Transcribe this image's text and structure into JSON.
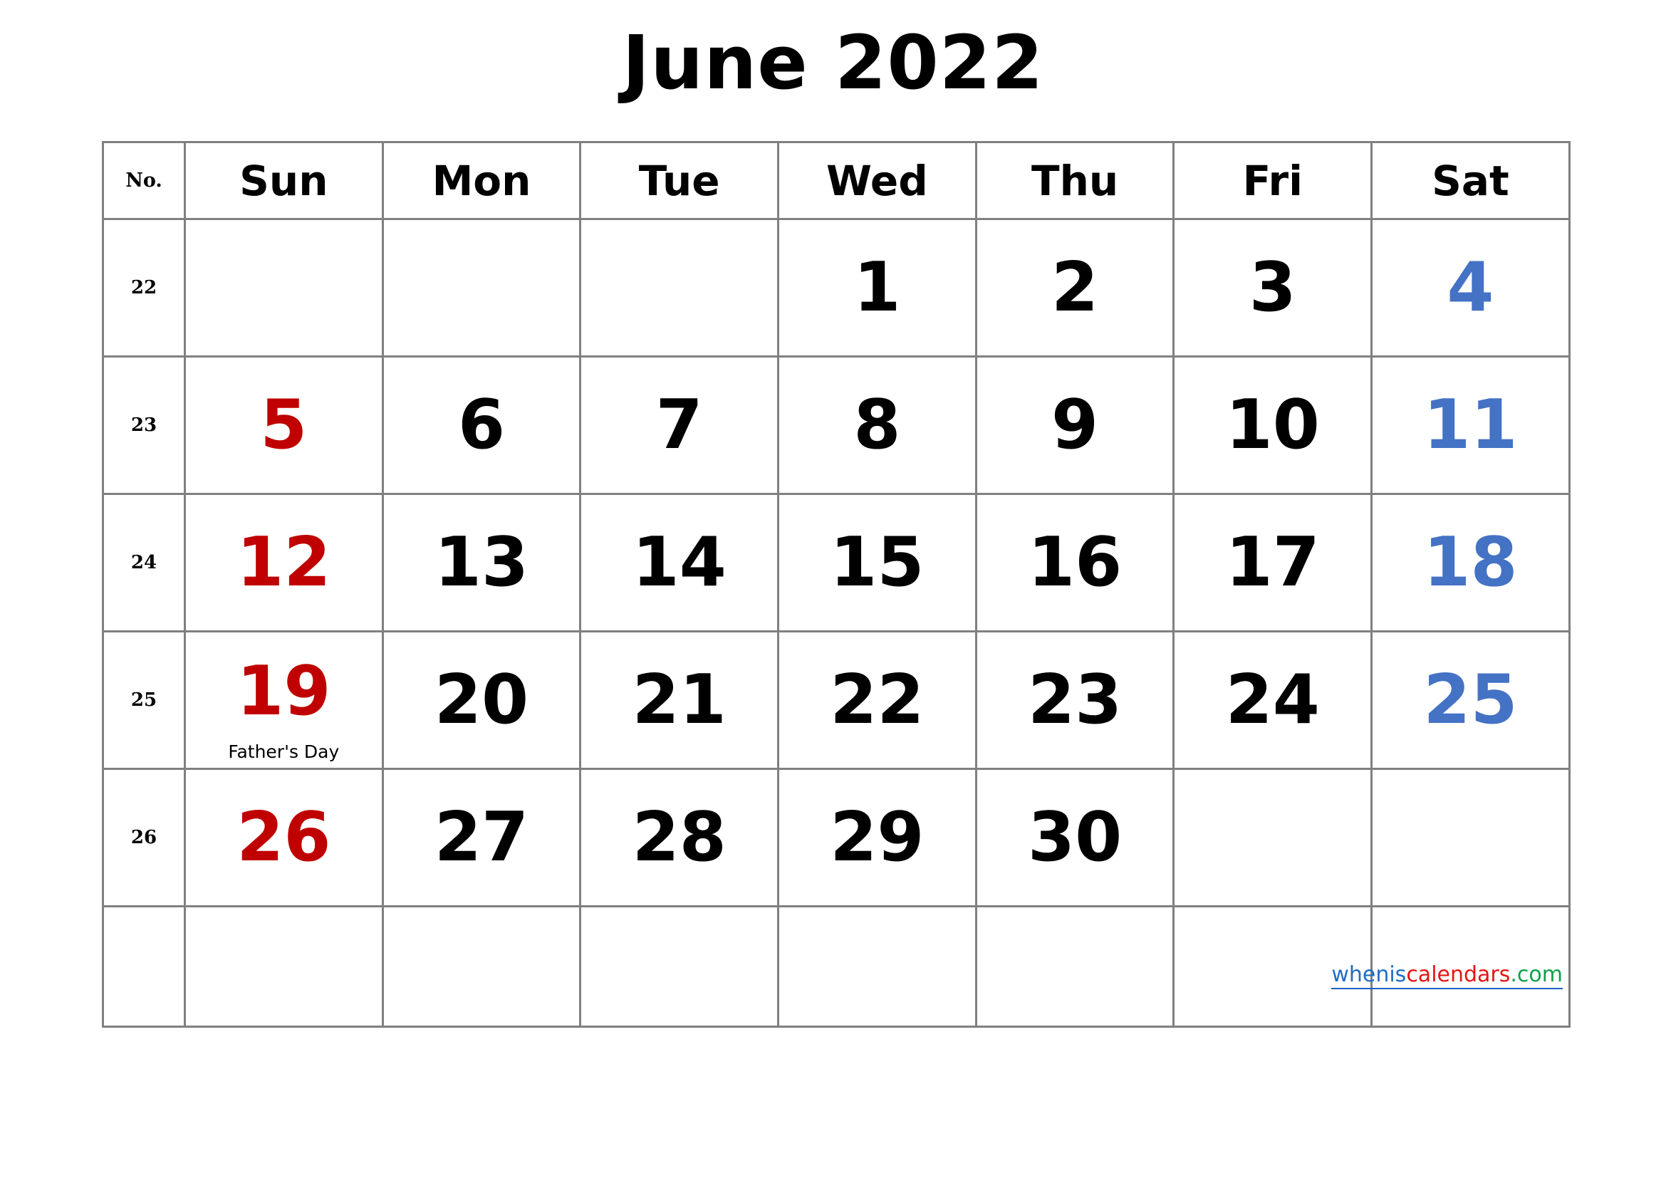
{
  "title": "June 2022",
  "table": {
    "week_number_header": "No.",
    "day_headers": [
      "Sun",
      "Mon",
      "Tue",
      "Wed",
      "Thu",
      "Fri",
      "Sat"
    ],
    "weeks": [
      {
        "week_number": "22",
        "days": [
          {
            "num": "",
            "type": "empty",
            "event": ""
          },
          {
            "num": "",
            "type": "empty",
            "event": ""
          },
          {
            "num": "",
            "type": "empty",
            "event": ""
          },
          {
            "num": "1",
            "type": "weekday",
            "event": ""
          },
          {
            "num": "2",
            "type": "weekday",
            "event": ""
          },
          {
            "num": "3",
            "type": "weekday",
            "event": ""
          },
          {
            "num": "4",
            "type": "saturday",
            "event": ""
          }
        ]
      },
      {
        "week_number": "23",
        "days": [
          {
            "num": "5",
            "type": "sunday",
            "event": ""
          },
          {
            "num": "6",
            "type": "weekday",
            "event": ""
          },
          {
            "num": "7",
            "type": "weekday",
            "event": ""
          },
          {
            "num": "8",
            "type": "weekday",
            "event": ""
          },
          {
            "num": "9",
            "type": "weekday",
            "event": ""
          },
          {
            "num": "10",
            "type": "weekday",
            "event": ""
          },
          {
            "num": "11",
            "type": "saturday",
            "event": ""
          }
        ]
      },
      {
        "week_number": "24",
        "days": [
          {
            "num": "12",
            "type": "sunday",
            "event": ""
          },
          {
            "num": "13",
            "type": "weekday",
            "event": ""
          },
          {
            "num": "14",
            "type": "weekday",
            "event": ""
          },
          {
            "num": "15",
            "type": "weekday",
            "event": ""
          },
          {
            "num": "16",
            "type": "weekday",
            "event": ""
          },
          {
            "num": "17",
            "type": "weekday",
            "event": ""
          },
          {
            "num": "18",
            "type": "saturday",
            "event": ""
          }
        ]
      },
      {
        "week_number": "25",
        "days": [
          {
            "num": "19",
            "type": "sunday",
            "event": "Father's Day"
          },
          {
            "num": "20",
            "type": "weekday",
            "event": ""
          },
          {
            "num": "21",
            "type": "weekday",
            "event": ""
          },
          {
            "num": "22",
            "type": "weekday",
            "event": ""
          },
          {
            "num": "23",
            "type": "weekday",
            "event": ""
          },
          {
            "num": "24",
            "type": "weekday",
            "event": ""
          },
          {
            "num": "25",
            "type": "saturday",
            "event": ""
          }
        ]
      },
      {
        "week_number": "26",
        "days": [
          {
            "num": "26",
            "type": "sunday",
            "event": ""
          },
          {
            "num": "27",
            "type": "weekday",
            "event": ""
          },
          {
            "num": "28",
            "type": "weekday",
            "event": ""
          },
          {
            "num": "29",
            "type": "weekday",
            "event": ""
          },
          {
            "num": "30",
            "type": "weekday",
            "event": ""
          },
          {
            "num": "",
            "type": "empty",
            "event": ""
          },
          {
            "num": "",
            "type": "empty",
            "event": ""
          }
        ]
      },
      {
        "week_number": "",
        "days": [
          {
            "num": "",
            "type": "empty",
            "event": ""
          },
          {
            "num": "",
            "type": "empty",
            "event": ""
          },
          {
            "num": "",
            "type": "empty",
            "event": ""
          },
          {
            "num": "",
            "type": "empty",
            "event": ""
          },
          {
            "num": "",
            "type": "empty",
            "event": ""
          },
          {
            "num": "",
            "type": "empty",
            "event": ""
          },
          {
            "num": "",
            "type": "empty",
            "event": ""
          }
        ]
      }
    ]
  },
  "watermark": {
    "part1": "whenis",
    "part2": "calendars",
    "part3": ".com"
  },
  "colors": {
    "sunday": "#C00000",
    "saturday": "#4472C4",
    "weekday": "#000000",
    "border": "#808080",
    "watermark_blue": "#1F6FC4",
    "watermark_red": "#E81313",
    "watermark_green": "#0FA04A"
  }
}
